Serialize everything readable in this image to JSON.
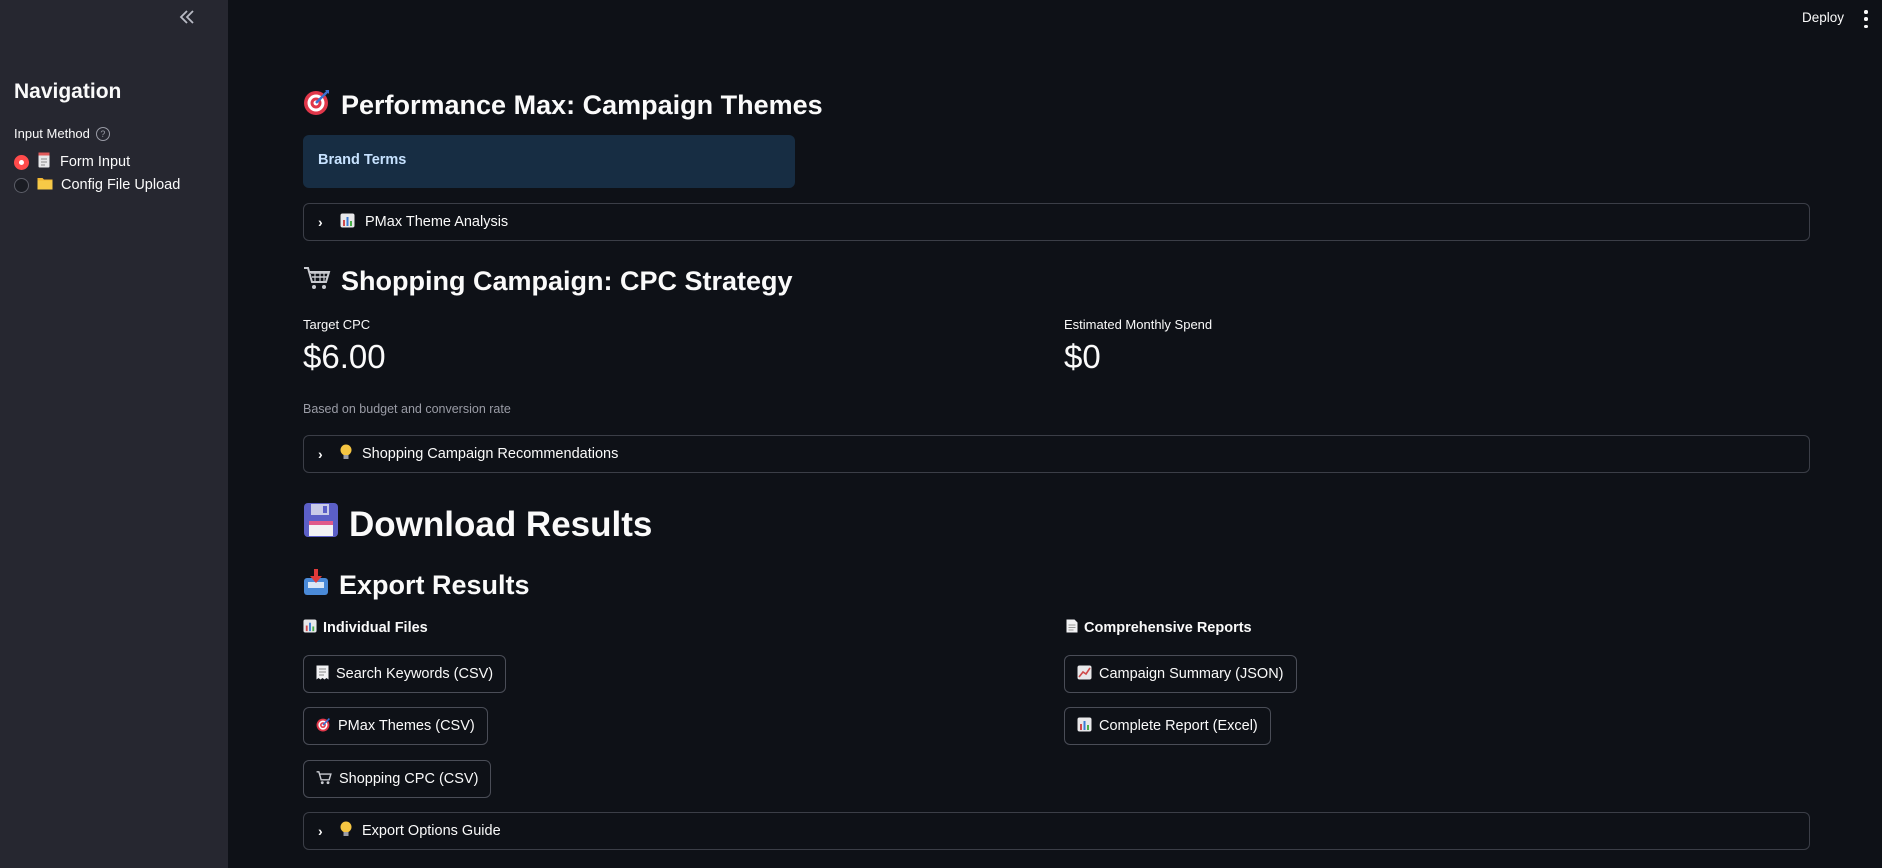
{
  "header": {
    "deploy_label": "Deploy"
  },
  "sidebar": {
    "title": "Navigation",
    "radio_label": "Input Method",
    "options": [
      {
        "label": "Form Input",
        "selected": true,
        "icon": "memo-icon"
      },
      {
        "label": "Config File Upload",
        "selected": false,
        "icon": "folder-icon"
      }
    ]
  },
  "pmax": {
    "heading": "Performance Max: Campaign Themes",
    "heading_icon": "target-icon",
    "info_text": "Brand Terms",
    "expander_label": "PMax Theme Analysis",
    "expander_icon": "bar-chart-icon"
  },
  "shopping": {
    "heading": "Shopping Campaign: CPC Strategy",
    "heading_icon": "cart-icon",
    "target_cpc_label": "Target CPC",
    "target_cpc_value": "$6.00",
    "monthly_spend_label": "Estimated Monthly Spend",
    "monthly_spend_value": "$0",
    "caption": "Based on budget and conversion rate",
    "expander_label": "Shopping Campaign Recommendations",
    "expander_icon": "lightbulb-icon"
  },
  "download": {
    "heading": "Download Results",
    "heading_icon": "floppy-disk-icon"
  },
  "export": {
    "heading": "Export Results",
    "heading_icon": "inbox-tray-icon",
    "individual_heading": "Individual Files",
    "comprehensive_heading": "Comprehensive Reports",
    "individual_buttons": [
      {
        "label": "Search Keywords (CSV)",
        "icon": "receipt-icon"
      },
      {
        "label": "PMax Themes (CSV)",
        "icon": "target-icon"
      },
      {
        "label": "Shopping CPC (CSV)",
        "icon": "cart-icon"
      }
    ],
    "comprehensive_buttons": [
      {
        "label": "Campaign Summary (JSON)",
        "icon": "chart-increasing-icon"
      },
      {
        "label": "Complete Report (Excel)",
        "icon": "bar-chart-icon"
      }
    ],
    "guide_label": "Export Options Guide",
    "guide_icon": "lightbulb-icon"
  },
  "colors": {
    "background": "#0e1117",
    "sidebar": "#262730",
    "accent": "#ff4b4b",
    "info_bg": "#172d43",
    "info_text": "#c7e2ff"
  }
}
